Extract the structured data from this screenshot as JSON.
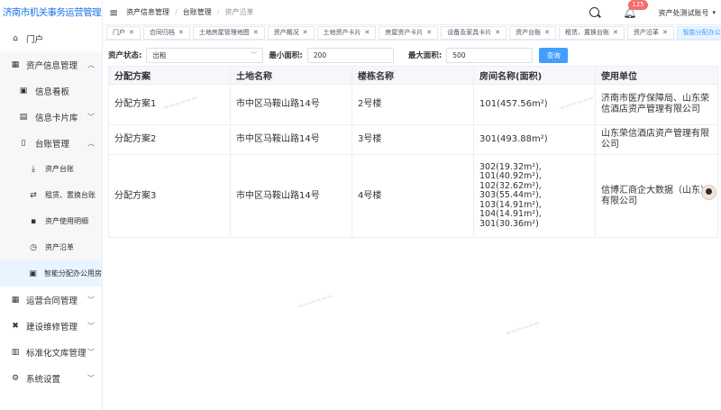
{
  "app_title": "济南市机关事务运营管理系统",
  "sidebar": {
    "items": [
      {
        "label": "门户",
        "icon": "home-icon",
        "level": 1
      },
      {
        "label": "资产信息管理",
        "icon": "grid-icon",
        "level": 1,
        "expanded": true
      },
      {
        "label": "信息看板",
        "icon": "dashboard-icon",
        "level": 2
      },
      {
        "label": "信息卡片库",
        "icon": "card-icon",
        "level": 2,
        "expanded": false
      },
      {
        "label": "台账管理",
        "icon": "ledger-icon",
        "level": 2,
        "expanded": true
      },
      {
        "label": "资产台账",
        "icon": "download-icon",
        "level": 3
      },
      {
        "label": "租赁、置换台账",
        "icon": "swap-icon",
        "level": 3
      },
      {
        "label": "资产使用明细",
        "icon": "detail-icon",
        "level": 3
      },
      {
        "label": "资产沿革",
        "icon": "history-icon",
        "level": 3
      },
      {
        "label": "智能分配办公用房",
        "icon": "allocate-icon",
        "level": 3,
        "active": true
      },
      {
        "label": "运营合同管理",
        "icon": "contract-icon",
        "level": 1
      },
      {
        "label": "建设维修管理",
        "icon": "wrench-icon",
        "level": 1
      },
      {
        "label": "标准化文库管理",
        "icon": "library-icon",
        "level": 1
      },
      {
        "label": "系统设置",
        "icon": "settings-icon",
        "level": 1
      }
    ]
  },
  "header": {
    "breadcrumb": [
      "资产信息管理",
      "台账管理",
      "资产沿革"
    ],
    "notification_count": "125",
    "user": "资产处测试账号"
  },
  "tabs": [
    {
      "label": "门户"
    },
    {
      "label": "合同归档"
    },
    {
      "label": "土地房屋管理地图"
    },
    {
      "label": "资产概况"
    },
    {
      "label": "土地资产卡片"
    },
    {
      "label": "房屋资产卡片"
    },
    {
      "label": "设备及家具卡片"
    },
    {
      "label": "资产台账"
    },
    {
      "label": "租赁、置换台账"
    },
    {
      "label": "资产沿革"
    },
    {
      "label": "智能分配办公用房",
      "active": true
    }
  ],
  "filter": {
    "status_label": "资产状态:",
    "status_value": "出租",
    "min_area_label": "最小面积:",
    "min_area_value": "200",
    "max_area_label": "最大面积:",
    "max_area_value": "500",
    "query_button": "查询"
  },
  "table": {
    "headers": [
      "分配方案",
      "土地名称",
      "楼栋名称",
      "房间名称(面积)",
      "使用单位"
    ],
    "rows": [
      {
        "scheme": "分配方案1",
        "land": "市中区马鞍山路14号",
        "building": "2号楼",
        "rooms": [
          "101(457.56m²)"
        ],
        "unit": "济南市医疗保障局、山东荣信酒店资产管理有限公司"
      },
      {
        "scheme": "分配方案2",
        "land": "市中区马鞍山路14号",
        "building": "3号楼",
        "rooms": [
          "301(493.88m²)"
        ],
        "unit": "山东荣信酒店资产管理有限公司"
      },
      {
        "scheme": "分配方案3",
        "land": "市中区马鞍山路14号",
        "building": "4号楼",
        "rooms": [
          "302(19.32m²),",
          "101(40.92m²),",
          "102(32.62m²),",
          "303(55.44m²),",
          "103(14.91m²),",
          "104(14.91m²),",
          "301(30.36m²)"
        ],
        "unit": "信博汇商企大数据（山东）有限公司"
      }
    ]
  }
}
